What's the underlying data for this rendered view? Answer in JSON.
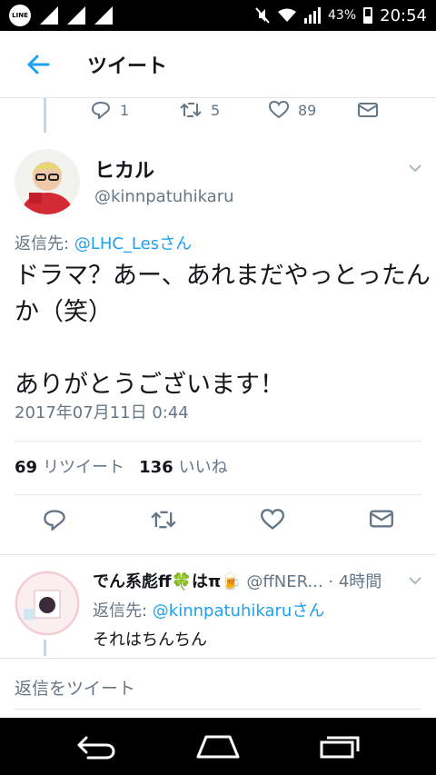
{
  "status_bar": {
    "app_badge": "LINE",
    "battery": "43%",
    "battery_level": 0.43,
    "time": "20:54"
  },
  "header": {
    "title": "ツイート"
  },
  "previous_tweet": {
    "replies": "1",
    "retweets": "5",
    "likes": "89"
  },
  "main_tweet": {
    "name": "ヒカル",
    "handle": "@kinnpatuhikaru",
    "reply_prefix": "返信先: ",
    "reply_target": "@LHC_Lesさん",
    "body_line1": "ドラマ？あー、あれまだやっとったんか（笑）",
    "body_line2": "ありがとうございます！",
    "timestamp": "2017年07月11日 0:44",
    "retweet_count": "69",
    "retweet_label": "リツイート",
    "like_count": "136",
    "like_label": "いいね"
  },
  "reply_tweet": {
    "name": "でん系彪ff🍀はπ🍺",
    "handle": "@ffNER...",
    "time": "· 4時間",
    "reply_prefix": "返信先: ",
    "reply_target": "@kinnpatuhikaruさん",
    "text": "それはちんちん"
  },
  "compose": {
    "placeholder": "返信をツイート"
  },
  "colors": {
    "accent": "#1da1f2",
    "muted": "#657786",
    "divider": "#e1e8ed"
  },
  "icons": [
    "back-arrow-icon",
    "reply-icon",
    "retweet-icon",
    "heart-icon",
    "mail-icon",
    "chevron-down-icon",
    "nav-back-icon",
    "nav-home-icon",
    "nav-recents-icon"
  ]
}
